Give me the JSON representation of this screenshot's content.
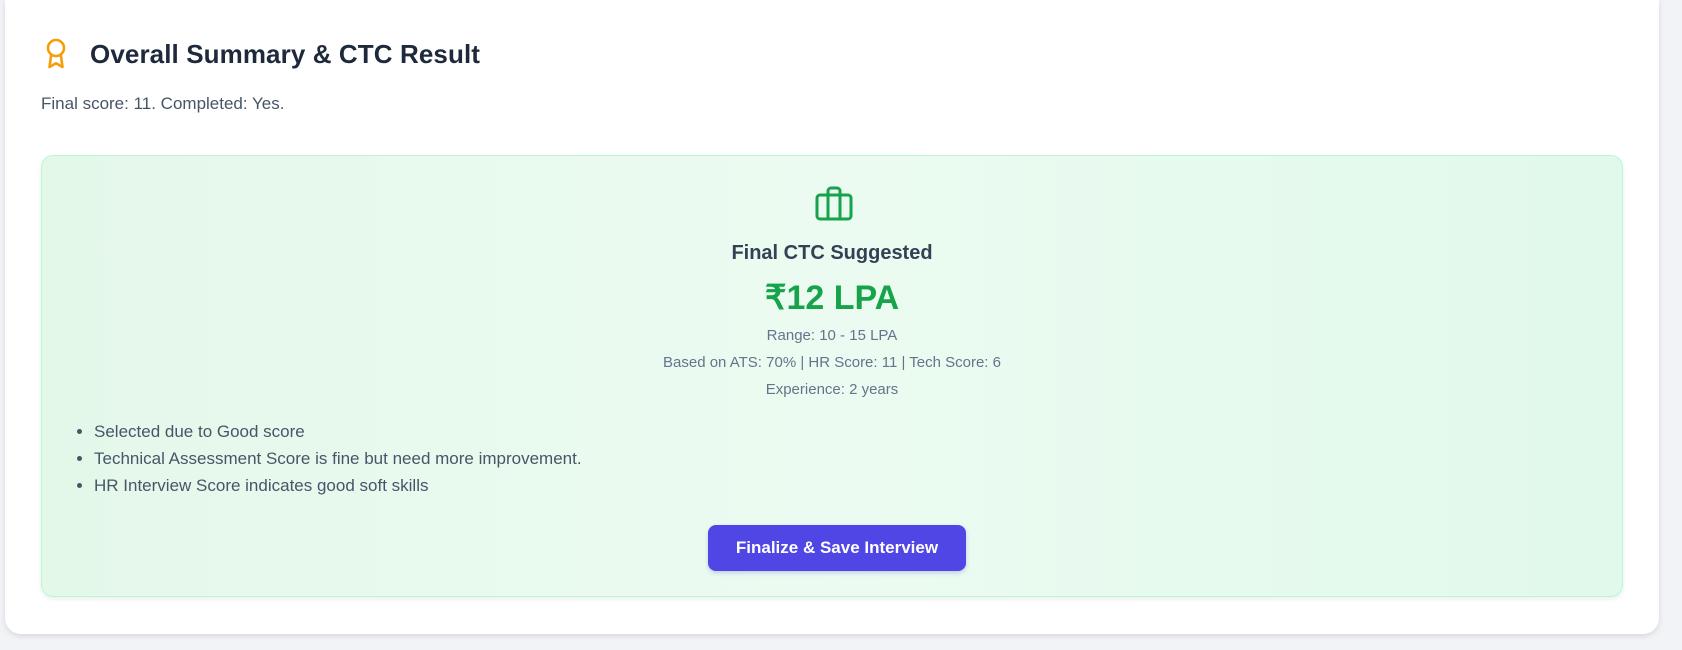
{
  "summary": {
    "title": "Overall Summary & CTC Result",
    "subtitle": "Final score: 11. Completed: Yes.",
    "header_icon": "award-icon"
  },
  "ctc": {
    "icon": "briefcase-icon",
    "label": "Final CTC Suggested",
    "value": "₹12 LPA",
    "range": "Range: 10 - 15 LPA",
    "basis": "Based on ATS: 70% | HR Score: 11 | Tech Score: 6",
    "experience": "Experience: 2 years",
    "reasons": [
      "Selected due to Good score",
      "Technical Assessment Score is fine but need more improvement.",
      "HR Interview Score indicates good soft skills"
    ]
  },
  "actions": {
    "finalize_label": "Finalize & Save Interview"
  },
  "colors": {
    "accent": "#4f46e5",
    "success": "#16a34a",
    "award": "#f59e0b"
  }
}
